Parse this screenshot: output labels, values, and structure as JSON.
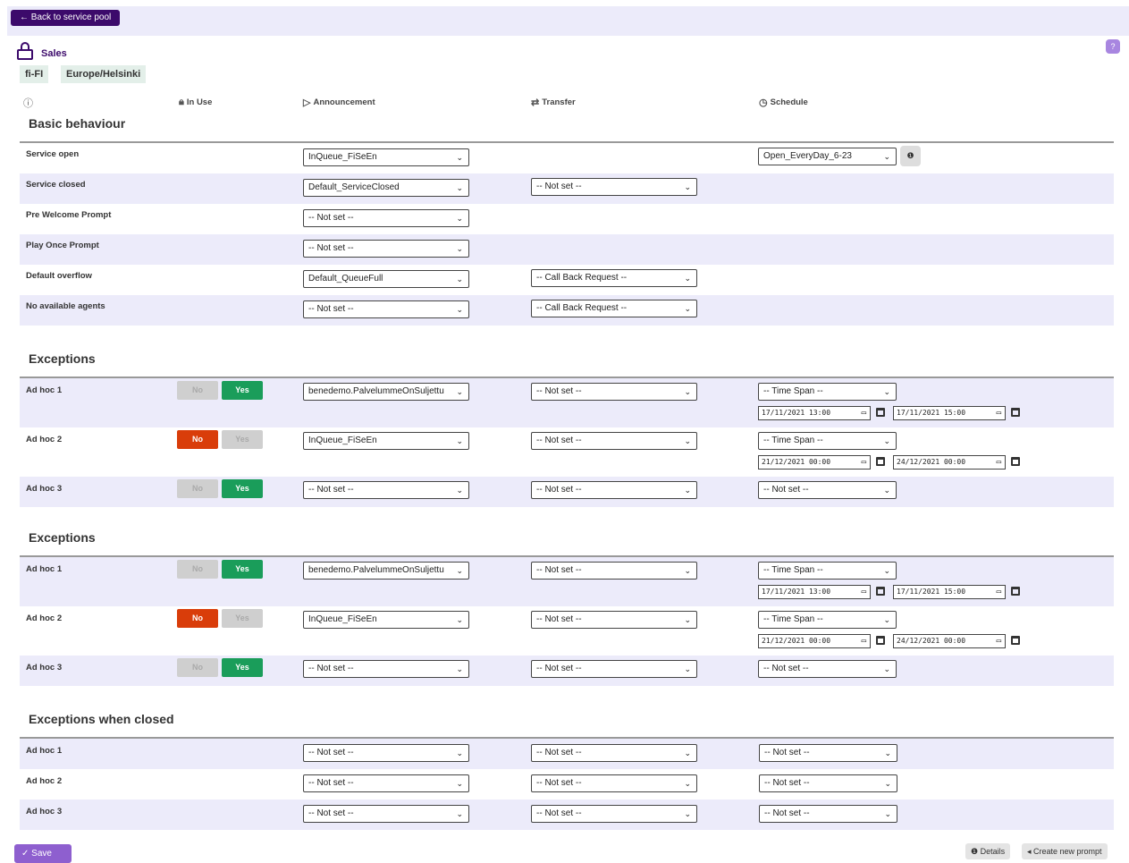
{
  "back_button": "← Back to service pool",
  "help": "?",
  "title": "Sales",
  "tags": [
    "fi-FI",
    "Europe/Helsinki"
  ],
  "columns": {
    "info": "ⓘ",
    "in_use": "In Use",
    "announcement": "Announcement",
    "transfer": "Transfer",
    "schedule": "Schedule"
  },
  "basic": {
    "title": "Basic behaviour",
    "rows": [
      {
        "label": "Service open",
        "announcement": "InQueue_FiSeEn",
        "transfer": "",
        "schedule": "Open_EveryDay_6-23"
      },
      {
        "label": "Service closed",
        "announcement": "Default_ServiceClosed",
        "transfer": "-- Not set --",
        "schedule": ""
      },
      {
        "label": "Pre Welcome Prompt",
        "announcement": "-- Not set --",
        "transfer": "",
        "schedule": ""
      },
      {
        "label": "Play Once Prompt",
        "announcement": "-- Not set --",
        "transfer": "",
        "schedule": ""
      },
      {
        "label": "Default overflow",
        "announcement": "Default_QueueFull",
        "transfer": "-- Call Back Request --",
        "schedule": ""
      },
      {
        "label": "No available agents",
        "announcement": "-- Not set --",
        "transfer": "-- Call Back Request --",
        "schedule": ""
      }
    ]
  },
  "exceptions1": {
    "title": "Exceptions",
    "rows": [
      {
        "label": "Ad hoc 1",
        "no": "No",
        "yes": "Yes",
        "active": "yes",
        "announcement": "benedemo.PalvelummeOnSuljettu",
        "transfer": "-- Not set --",
        "schedule": "-- Time Span --",
        "from": "17/11/2021 13:00",
        "to": "17/11/2021 15:00"
      },
      {
        "label": "Ad hoc 2",
        "no": "No",
        "yes": "Yes",
        "active": "no",
        "announcement": "InQueue_FiSeEn",
        "transfer": "-- Not set --",
        "schedule": "-- Time Span --",
        "from": "21/12/2021 00:00",
        "to": "24/12/2021 00:00"
      },
      {
        "label": "Ad hoc 3",
        "no": "No",
        "yes": "Yes",
        "active": "yes",
        "announcement": "-- Not set --",
        "transfer": "-- Not set --",
        "schedule": "-- Not set --"
      }
    ]
  },
  "exceptions2": {
    "title": "Exceptions",
    "rows": [
      {
        "label": "Ad hoc 1",
        "no": "No",
        "yes": "Yes",
        "active": "yes",
        "announcement": "benedemo.PalvelummeOnSuljettu",
        "transfer": "-- Not set --",
        "schedule": "-- Time Span --",
        "from": "17/11/2021 13:00",
        "to": "17/11/2021 15:00"
      },
      {
        "label": "Ad hoc 2",
        "no": "No",
        "yes": "Yes",
        "active": "no",
        "announcement": "InQueue_FiSeEn",
        "transfer": "-- Not set --",
        "schedule": "-- Time Span --",
        "from": "21/12/2021 00:00",
        "to": "24/12/2021 00:00"
      },
      {
        "label": "Ad hoc 3",
        "no": "No",
        "yes": "Yes",
        "active": "yes",
        "announcement": "-- Not set --",
        "transfer": "-- Not set --",
        "schedule": "-- Not set --"
      }
    ]
  },
  "closed": {
    "title": "Exceptions when closed",
    "rows": [
      {
        "label": "Ad hoc 1",
        "announcement": "-- Not set --",
        "transfer": "-- Not set --",
        "schedule": "-- Not set --"
      },
      {
        "label": "Ad hoc 2",
        "announcement": "-- Not set --",
        "transfer": "-- Not set --",
        "schedule": "-- Not set --"
      },
      {
        "label": "Ad hoc 3",
        "announcement": "-- Not set --",
        "transfer": "-- Not set --",
        "schedule": "-- Not set --"
      }
    ]
  },
  "footer": {
    "save": "✓ Save",
    "details": "❶ Details",
    "create_prompt": "◂ Create new prompt"
  },
  "colors": {
    "brand": "#3c0a6b",
    "yes": "#1a9d5a",
    "no": "#d93d0a",
    "row_alt": "#ecebfa"
  }
}
